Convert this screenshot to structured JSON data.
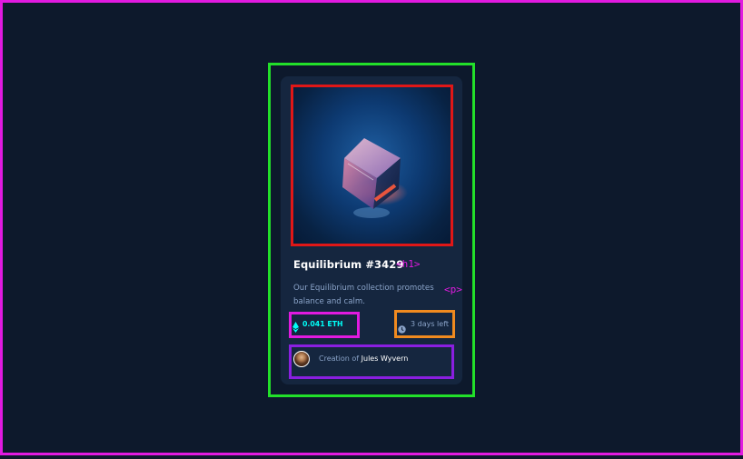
{
  "card": {
    "title": "Equilibrium #3429",
    "description": "Our Equilibrium collection promotes balance and calm.",
    "price": "0.041 ETH",
    "time_left": "3 days left",
    "creator_prefix": "Creation of ",
    "creator_name": "Jules Wyvern"
  },
  "annotations": {
    "h1_tag": "<h1>",
    "p_tag": "<p>"
  },
  "icons": {
    "price": "ethereum-icon",
    "time": "clock-icon"
  },
  "colors": {
    "background": "#0d192c",
    "card": "#15263f",
    "accent_cyan": "#00fff8",
    "muted_text": "#8aa3c8",
    "outline_page": "#e11ae0",
    "outline_card": "#22e02a",
    "outline_image": "#e01717",
    "outline_price": "#e11ae0",
    "outline_time": "#f08a1f",
    "outline_creator": "#8a1fe0"
  }
}
